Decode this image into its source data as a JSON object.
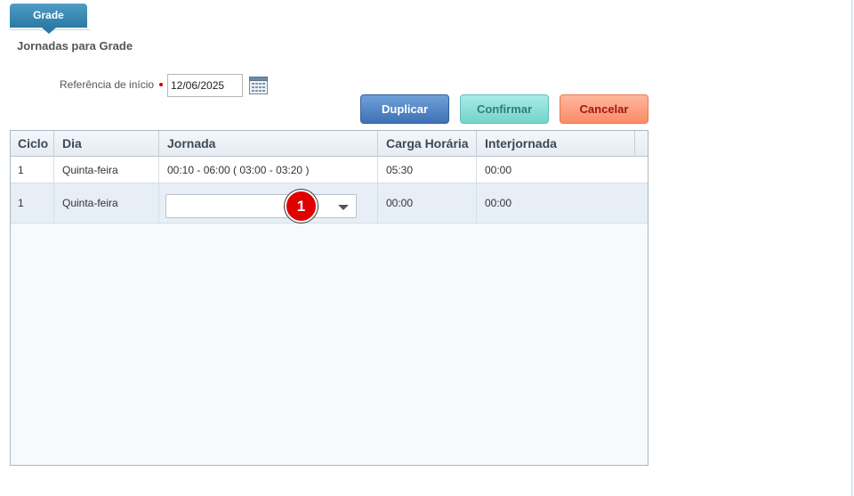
{
  "tab": {
    "label": "Grade"
  },
  "page": {
    "title": "Jornadas para Grade"
  },
  "form": {
    "reference_label": "Referência de início",
    "reference_value": "12/06/2025"
  },
  "buttons": {
    "duplicate": "Duplicar",
    "confirm": "Confirmar",
    "cancel": "Cancelar"
  },
  "grid": {
    "columns": [
      "Ciclo",
      "Dia",
      "Jornada",
      "Carga Horária",
      "Interjornada"
    ],
    "rows": [
      {
        "ciclo": "1",
        "dia": "Quinta-feira",
        "jornada": "00:10 - 06:00 ( 03:00 - 03:20 )",
        "carga": "05:30",
        "interjornada": "00:00"
      },
      {
        "ciclo": "1",
        "dia": "Quinta-feira",
        "jornada": "",
        "carga": "00:00",
        "interjornada": "00:00"
      }
    ]
  },
  "annotation": {
    "badge": "1"
  },
  "colors": {
    "tab": "#2b7aa6",
    "duplicate": "#3f72b5",
    "confirm": "#74d3cb",
    "cancel": "#fb8b67",
    "badge": "#e00000"
  },
  "icons": {
    "calendar": "calendar-icon",
    "dropdown": "chevron-down-icon"
  }
}
